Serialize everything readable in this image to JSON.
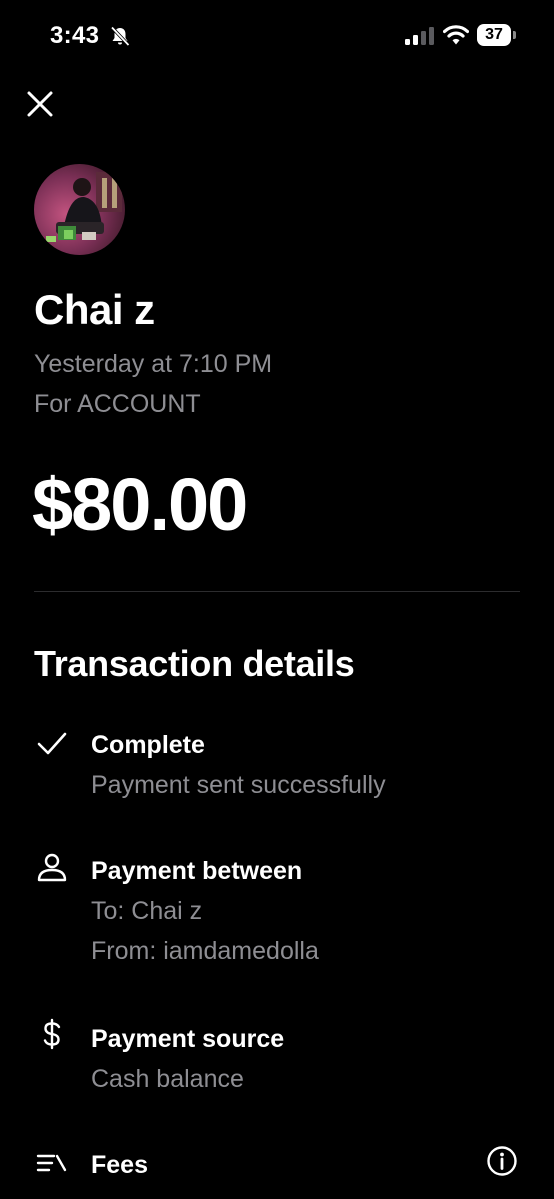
{
  "status_bar": {
    "time": "3:43",
    "battery": "37"
  },
  "transaction": {
    "name": "Chai z",
    "date": "Yesterday at 7:10 PM",
    "note": "For ACCOUNT",
    "amount": "$80.00"
  },
  "details": {
    "title": "Transaction details",
    "status": {
      "icon": "checkmark-icon",
      "title": "Complete",
      "subtitle": "Payment sent successfully"
    },
    "parties": {
      "icon": "person-icon",
      "title": "Payment between",
      "to": "To: Chai z",
      "from": "From: iamdamedolla"
    },
    "source": {
      "icon": "dollar-icon",
      "title": "Payment source",
      "subtitle": "Cash balance"
    },
    "fees": {
      "icon": "fees-list-icon",
      "title": "Fees",
      "info_icon": "info-icon"
    }
  },
  "colors": {
    "background": "#000000",
    "text_primary": "#ffffff",
    "text_secondary": "#8e8e93",
    "divider": "#2c2c2e"
  }
}
